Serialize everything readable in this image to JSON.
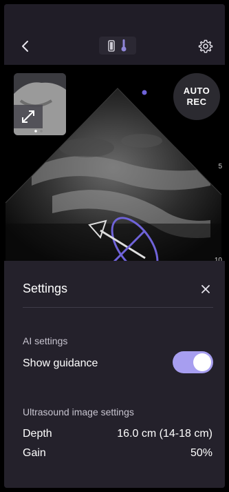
{
  "topbar": {
    "back_icon": "chevron-left-icon",
    "probe_icon": "battery-icon",
    "temp_icon": "thermometer-icon",
    "settings_icon": "gear-icon"
  },
  "viewport": {
    "auto_rec": {
      "line1": "AUTO",
      "line2": "REC"
    },
    "thumbnail_icon": "expand-icon",
    "depth_ticks": [
      "5",
      "10"
    ],
    "guidance_color": "#6f63d9"
  },
  "settings": {
    "title": "Settings",
    "ai_section": "AI settings",
    "show_guidance_label": "Show guidance",
    "show_guidance_on": true,
    "us_section": "Ultrasound image settings",
    "depth_label": "Depth",
    "depth_value": "16.0 cm (14-18 cm)",
    "gain_label": "Gain",
    "gain_value": "50%"
  },
  "colors": {
    "accent": "#a79ef0",
    "sheet_bg": "#24212b",
    "topbar_bg": "#201d27"
  }
}
